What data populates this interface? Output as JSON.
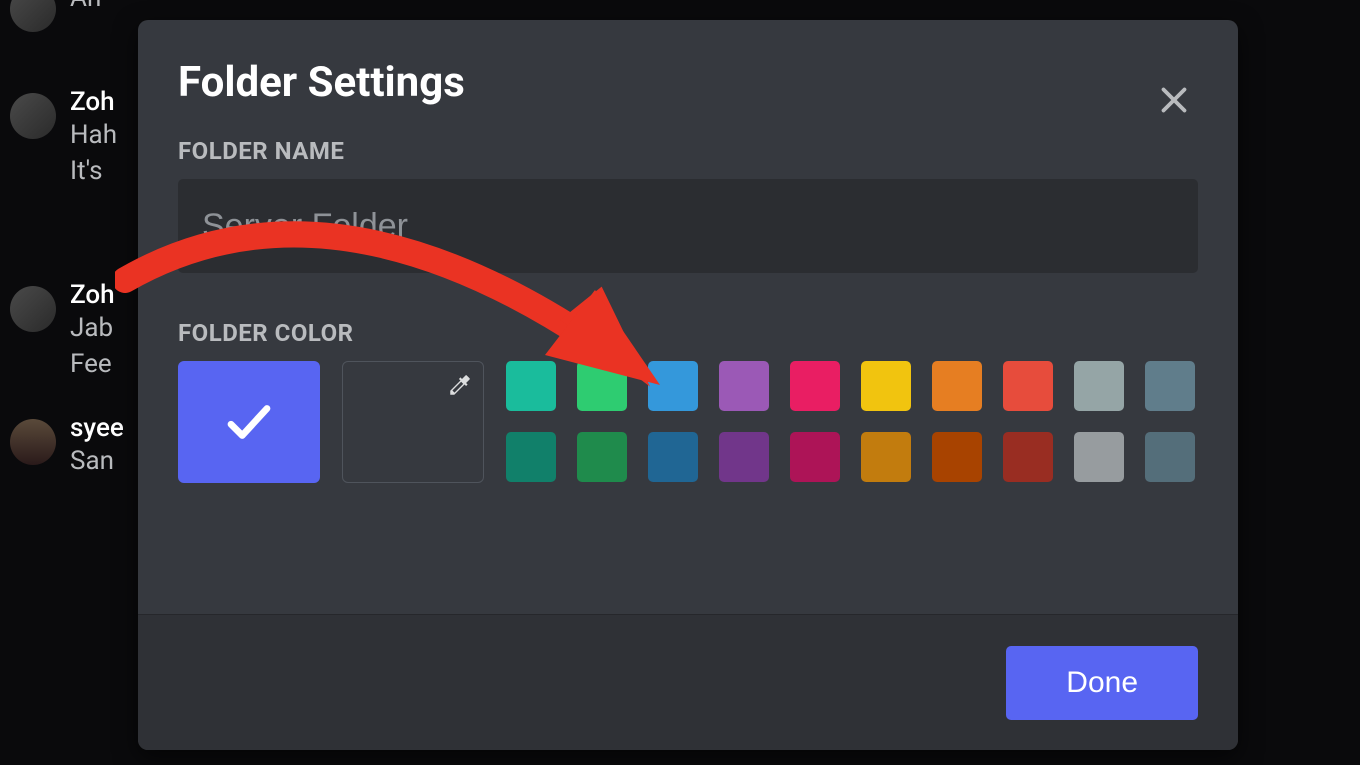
{
  "background_chat": [
    {
      "username": "",
      "lines": [
        "Ah"
      ]
    },
    {
      "username": "Zoh",
      "lines": [
        "Hah",
        "It's"
      ]
    },
    {
      "username": "Zoh",
      "lines": [
        "Jab",
        "Fee"
      ]
    },
    {
      "username": "syee",
      "lines": [
        "San"
      ]
    }
  ],
  "modal": {
    "title": "Folder Settings",
    "folder_name": {
      "label": "FOLDER NAME",
      "placeholder": "Server Folder",
      "value": ""
    },
    "folder_color": {
      "label": "FOLDER COLOR",
      "selected_color": "#5865f2",
      "preset_swatches_row1": [
        "#1abc9c",
        "#2ecc71",
        "#3498db",
        "#9b59b6",
        "#e91e63",
        "#f1c40f",
        "#e67e22",
        "#e74c3c",
        "#95a5a6",
        "#607d8b"
      ],
      "preset_swatches_row2": [
        "#11806a",
        "#1f8b4c",
        "#206694",
        "#71368a",
        "#ad1457",
        "#c27c0e",
        "#a84300",
        "#992d22",
        "#979c9f",
        "#546e7a"
      ]
    },
    "done_label": "Done"
  }
}
